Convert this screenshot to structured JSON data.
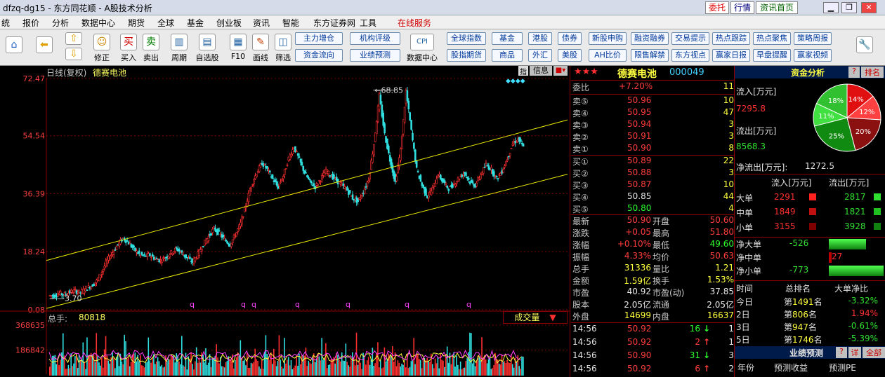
{
  "window": {
    "title": "dfzq-dg15 - 东方同花顺 - A股技术分析",
    "buttons": [
      "委托",
      "行情",
      "资讯首页"
    ]
  },
  "menu": [
    "统",
    "报价",
    "分析",
    "数据中心",
    "期货",
    "全球",
    "基金",
    "创业板",
    "资讯",
    "智能",
    "东方证券网",
    "工具",
    "在线服务"
  ],
  "toolbar": {
    "tools": [
      "修正",
      "买入",
      "卖出",
      "周期",
      "自选股",
      "F10",
      "画线",
      "筛选",
      "数据中心"
    ],
    "buttons": [
      "主力增仓",
      "机构评级",
      "资金流向",
      "业绩预测",
      "全球指数",
      "基金",
      "港股",
      "债券",
      "股指期货",
      "商品",
      "外汇",
      "美股",
      "新股申购",
      "融资融券",
      "交易提示",
      "热点跟踪",
      "热点聚焦",
      "策略周报",
      "AH比价",
      "限售解禁",
      "东方视点",
      "赢家日报",
      "早盘提醒",
      "赢家视频"
    ]
  },
  "chart": {
    "header": "日线(复权)",
    "stock_name": "德赛电池",
    "info_btn": "信息",
    "marker_btn": "指",
    "volume_label": "总手:",
    "volume_value": "80818",
    "volume_btn": "成交量",
    "price_ticks": [
      "72.47",
      "54.54",
      "36.39",
      "18.24",
      "0.08"
    ],
    "volume_ticks": [
      "368635",
      "186842"
    ],
    "annotations": {
      "high": "68.85",
      "low": "3.70"
    },
    "q_marks": [
      "q",
      "q",
      "q",
      "q",
      "q",
      "q",
      "q",
      "q"
    ]
  },
  "chart_data": {
    "type": "line",
    "title": "日线(复权) 德赛电池",
    "ylim": [
      0.08,
      72.47
    ],
    "y_ticks": [
      72.47,
      54.54,
      36.39,
      18.24,
      0.08
    ],
    "high": 68.85,
    "low": 3.7,
    "series": [
      {
        "values": [
          4.5,
          5.2,
          4.8,
          5.6,
          6.0,
          5.4,
          6.8,
          7.5,
          9.0,
          12.0,
          15.5,
          18.0,
          20.5,
          22.5,
          21.0,
          19.0,
          17.5,
          16.8,
          17.2,
          16.0,
          15.5,
          16.5,
          18.0,
          19.2,
          17.8,
          16.2,
          15.0,
          17.5,
          20.5,
          23.0,
          25.5,
          24.0,
          22.0,
          20.5,
          23.5,
          27.0,
          33.0,
          39.0,
          43.0,
          46.0,
          44.0,
          41.0,
          38.5,
          42.0,
          47.5,
          51.0,
          47.0,
          43.0,
          40.0,
          38.5,
          41.0,
          43.5,
          42.0,
          40.5,
          39.0,
          37.5,
          35.0,
          34.0,
          37.0,
          41.0,
          52.0,
          67.0,
          55.0,
          47.0,
          40.0,
          50.0,
          68.5,
          56.0,
          44.0,
          39.0,
          35.5,
          38.0,
          42.5,
          40.0,
          38.0,
          39.5,
          41.5,
          43.0,
          40.0,
          39.0,
          42.5,
          45.5,
          44.0,
          41.0,
          43.5,
          47.5,
          52.0,
          53.5,
          50.9
        ]
      }
    ],
    "volume": {
      "ylim": [
        0,
        368635
      ],
      "ticks": [
        368635,
        186842
      ],
      "last": 80818
    }
  },
  "quote": {
    "stars": "★★★",
    "name": "德赛电池",
    "code": "000049",
    "weibi_label": "委比",
    "weibi": "+7.20%",
    "weibi_v": "11",
    "sell": [
      {
        "l": "卖⑤",
        "p": "50.96",
        "v": "10"
      },
      {
        "l": "卖④",
        "p": "50.95",
        "v": "47"
      },
      {
        "l": "卖③",
        "p": "50.94",
        "v": "3"
      },
      {
        "l": "卖②",
        "p": "50.91",
        "v": "3"
      },
      {
        "l": "卖①",
        "p": "50.90",
        "v": "8"
      }
    ],
    "buy": [
      {
        "l": "买①",
        "p": "50.89",
        "v": "22"
      },
      {
        "l": "买②",
        "p": "50.88",
        "v": "3"
      },
      {
        "l": "买③",
        "p": "50.87",
        "v": "10"
      },
      {
        "l": "买④",
        "p": "50.85",
        "v": "44"
      },
      {
        "l": "买⑤",
        "p": "50.80",
        "v": "4"
      }
    ],
    "stats": [
      {
        "l1": "最新",
        "v1": "50.90",
        "l2": "开盘",
        "v2": "50.60"
      },
      {
        "l1": "涨跌",
        "v1": "+0.05",
        "l2": "最高",
        "v2": "51.80"
      },
      {
        "l1": "涨幅",
        "v1": "+0.10%",
        "l2": "最低",
        "v2": "49.60"
      },
      {
        "l1": "振幅",
        "v1": "4.33%",
        "l2": "均价",
        "v2": "50.63"
      },
      {
        "l1": "总手",
        "v1": "31336",
        "l2": "量比",
        "v2": "1.21"
      },
      {
        "l1": "金额",
        "v1": "1.59亿",
        "l2": "换手",
        "v2": "1.53%"
      },
      {
        "l1": "市盈",
        "v1": "40.92",
        "l2": "市盈(动)",
        "v2": "37.85"
      },
      {
        "l1": "股本",
        "v1": "2.05亿",
        "l2": "流通",
        "v2": "2.05亿"
      },
      {
        "l1": "外盘",
        "v1": "14699",
        "l2": "内盘",
        "v2": "16637"
      }
    ],
    "ticks": [
      {
        "t": "14:56",
        "p": "50.92",
        "v": "16",
        "d": "down",
        "n": "1"
      },
      {
        "t": "14:56",
        "p": "50.92",
        "v": "2",
        "d": "up",
        "n": "1"
      },
      {
        "t": "14:56",
        "p": "50.90",
        "v": "31",
        "d": "down",
        "n": "3"
      },
      {
        "t": "14:56",
        "p": "50.92",
        "v": "6",
        "d": "up",
        "n": "2"
      }
    ]
  },
  "capital": {
    "title": "资金分析",
    "help": "?",
    "rank_btn": "排名",
    "inflow_label": "流入[万元]",
    "inflow": "7295.8",
    "outflow_label": "流出[万元]",
    "outflow": "8568.3",
    "net_label": "净流出[万元]:",
    "net": "1272.5",
    "pie": [
      {
        "label": "14%",
        "value": 14,
        "color": "#e01010"
      },
      {
        "label": "12%",
        "value": 12,
        "color": "#ff4040"
      },
      {
        "label": "20%",
        "value": 20,
        "color": "#8b1010"
      },
      {
        "label": "25%",
        "value": 25,
        "color": "#108a10"
      },
      {
        "label": "11%",
        "value": 11,
        "color": "#40e040"
      },
      {
        "label": "18%",
        "value": 18,
        "color": "#30c030"
      }
    ],
    "col_in": "流入[万元]",
    "col_out": "流出[万元]",
    "rows": [
      {
        "l": "大单",
        "in": "2291",
        "out": "2817"
      },
      {
        "l": "中单",
        "in": "1849",
        "out": "1821"
      },
      {
        "l": "小单",
        "in": "3155",
        "out": "3928"
      }
    ],
    "net_rows": [
      {
        "l": "净大单",
        "v": "-526",
        "color": "green",
        "frac": 0.68
      },
      {
        "l": "净中单",
        "v": "27",
        "color": "red",
        "frac": 0.05
      },
      {
        "l": "净小单",
        "v": "-773",
        "color": "green",
        "frac": 1.0
      }
    ],
    "rank_header": {
      "c1": "时间",
      "c2": "总排名",
      "c3": "大单净比"
    },
    "rank_rows": [
      {
        "t": "今日",
        "r": "1491",
        "p": "-3.32%"
      },
      {
        "t": "2日",
        "r": "806",
        "p": "1.94%"
      },
      {
        "t": "3日",
        "r": "947",
        "p": "-0.61%"
      },
      {
        "t": "5日",
        "r": "1746",
        "p": "-5.39%"
      }
    ],
    "rank_prefix": "第",
    "rank_suffix": "名",
    "forecast_title": "业绩预测",
    "forecast_help": "?",
    "forecast_detail": "详",
    "forecast_all": "全部",
    "forecast_cols": [
      "年份",
      "预测收益",
      "预测PE"
    ]
  }
}
